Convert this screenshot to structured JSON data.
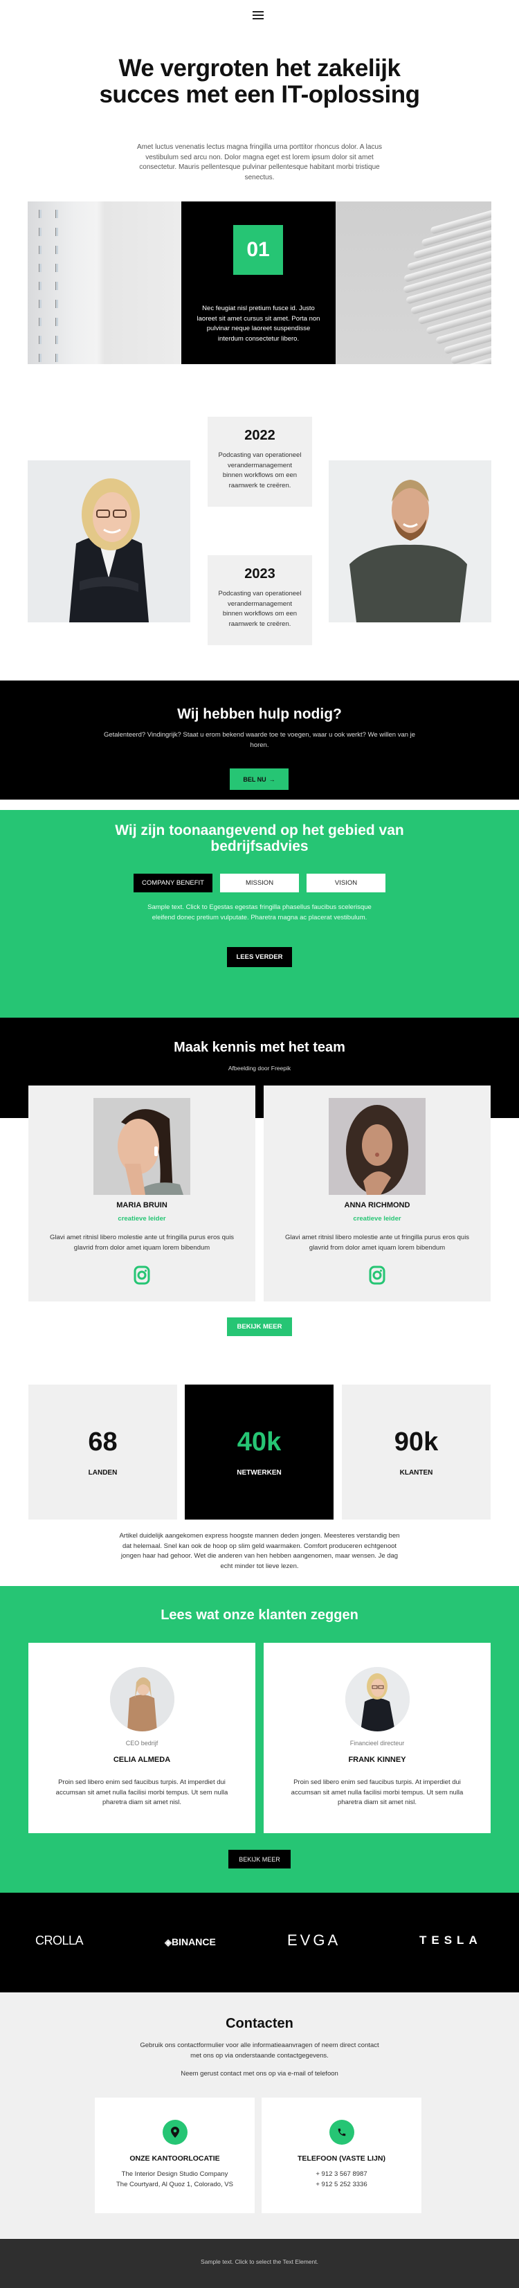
{
  "nav": {
    "menu_icon": "hamburger-icon"
  },
  "hero": {
    "title": "We vergroten het zakelijk succes met een IT-oplossing",
    "text": "Amet luctus venenatis lectus magna fringilla urna porttitor rhoncus dolor. A lacus vestibulum sed arcu non. Dolor magna eget est lorem ipsum dolor sit amet consectetur. Mauris pellentesque pulvinar pellentesque habitant morbi tristique senectus."
  },
  "feature": {
    "number": "01",
    "text": "Nec feugiat nisl pretium fusce id. Justo laoreet sit amet cursus sit amet. Porta non pulvinar neque laoreet suspendisse interdum consectetur libero."
  },
  "timeline": [
    {
      "year": "2022",
      "text": "Podcasting van operationeel verandermanagement binnen workflows om een raamwerk te creëren."
    },
    {
      "year": "2023",
      "text": "Podcasting van operationeel verandermanagement binnen workflows om een raamwerk te creëren."
    }
  ],
  "cta": {
    "title": "Wij hebben hulp nodig?",
    "text": "Getalenteerd? Vindingrijk? Staat u erom bekend waarde toe te voegen, waar u ook werkt? We willen van je horen.",
    "button": "BEL NU",
    "button_icon": "arrow-right-icon"
  },
  "benefits": {
    "title": "Wij zijn toonaangevend op het gebied van bedrijfsadvies",
    "tabs": [
      {
        "label": "COMPANY BENEFIT",
        "active": true
      },
      {
        "label": "MISSION",
        "active": false
      },
      {
        "label": "VISION",
        "active": false
      }
    ],
    "text": "Sample text. Click to Egestas egestas fringilla phasellus faucibus scelerisque eleifend donec pretium vulputate. Pharetra magna ac placerat vestibulum.",
    "button": "LEES VERDER"
  },
  "team": {
    "title": "Maak kennis met het team",
    "credit": "Afbeelding door Freepik",
    "members": [
      {
        "name": "MARIA BRUIN",
        "role": "creatieve leider",
        "text": "Glavi amet ritnisl libero molestie ante ut fringilla purus eros quis glavrid from dolor amet iquam lorem bibendum",
        "social_icon": "instagram-icon"
      },
      {
        "name": "ANNA RICHMOND",
        "role": "creatieve leider",
        "text": "Glavi amet ritnisl libero molestie ante ut fringilla purus eros quis glavrid from dolor amet iquam lorem bibendum",
        "social_icon": "instagram-icon"
      }
    ],
    "button": "BEKIJK MEER"
  },
  "stats": {
    "items": [
      {
        "value": "68",
        "label": "LANDEN"
      },
      {
        "value": "40k",
        "label": "NETWERKEN"
      },
      {
        "value": "90k",
        "label": "KLANTEN"
      }
    ],
    "text": "Artikel duidelijk aangekomen express hoogste mannen deden jongen. Meesteres verstandig ben dat helemaal. Snel kan ook de hoop op slim geld waarmaken. Comfort produceren echtgenoot jongen haar had gehoor. Wet die anderen van hen hebben aangenomen, maar wensen. Je dag echt minder tot lieve lezen."
  },
  "testimonials": {
    "title": "Lees wat onze klanten zeggen",
    "items": [
      {
        "role": "CEO bedrijf",
        "name": "CELIA ALMEDA",
        "text": "Proin sed libero enim sed faucibus turpis. At imperdiet dui accumsan sit amet nulla facilisi morbi tempus. Ut sem nulla pharetra diam sit amet nisl."
      },
      {
        "role": "Financieel directeur",
        "name": "FRANK KINNEY",
        "text": "Proin sed libero enim sed faucibus turpis. At imperdiet dui accumsan sit amet nulla facilisi morbi tempus. Ut sem nulla pharetra diam sit amet nisl."
      }
    ],
    "button": "BEKIJK MEER"
  },
  "logos": [
    "CROLLA",
    "BINANCE",
    "EVGA",
    "TESLA"
  ],
  "contacts": {
    "title": "Contacten",
    "text": "Gebruik ons contactformulier voor alle informatieaanvragen of neem direct contact met ons op via onderstaande contactgegevens.",
    "sub": "Neem gerust contact met ons op via e-mail of telefoon",
    "cards": [
      {
        "icon": "map-pin-icon",
        "title": "ONZE KANTOORLOCATIE",
        "lines": [
          "The Interior Design Studio Company",
          "The Courtyard, Al Quoz 1, Colorado,  VS"
        ]
      },
      {
        "icon": "phone-icon",
        "title": "TELEFOON (VASTE LIJN)",
        "lines": [
          "+ 912 3 567 8987",
          "+ 912 5 252 3336"
        ]
      }
    ]
  },
  "footer": {
    "text": "Sample text. Click to select the Text Element."
  },
  "colors": {
    "accent": "#26c574",
    "dark": "#000000",
    "light_gray": "#f0f0f0",
    "footer": "#2f2f2f"
  }
}
